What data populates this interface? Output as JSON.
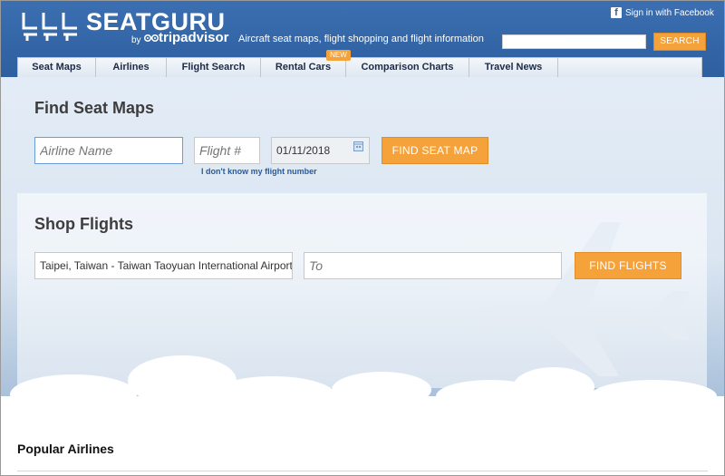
{
  "brand": {
    "name": "SEATGURU",
    "by": "by",
    "partner": "tripadvisor",
    "tagline": "Aircraft seat maps, flight shopping and flight information"
  },
  "header": {
    "facebook_label": "Sign in with Facebook",
    "search_button": "SEARCH"
  },
  "nav": {
    "items": [
      {
        "label": "Seat Maps"
      },
      {
        "label": "Airlines"
      },
      {
        "label": "Flight Search"
      },
      {
        "label": "Rental Cars"
      },
      {
        "label": "Comparison Charts"
      },
      {
        "label": "Travel News"
      }
    ],
    "new_badge": "NEW"
  },
  "find_seat_maps": {
    "title": "Find Seat Maps",
    "airline_placeholder": "Airline Name",
    "flight_placeholder": "Flight #",
    "date_value": "01/11/2018",
    "button": "FIND SEAT MAP",
    "dont_know_link": "I don't know my flight number"
  },
  "shop_flights": {
    "title": "Shop Flights",
    "from_value": "Taipei, Taiwan - Taiwan Taoyuan International Airport",
    "to_placeholder": "To",
    "button": "FIND FLIGHTS"
  },
  "popular_airlines": {
    "title": "Popular Airlines"
  },
  "colors": {
    "header_blue": "#3b6fb1",
    "accent_orange": "#f5a23a",
    "link_blue": "#2a5a9a"
  }
}
